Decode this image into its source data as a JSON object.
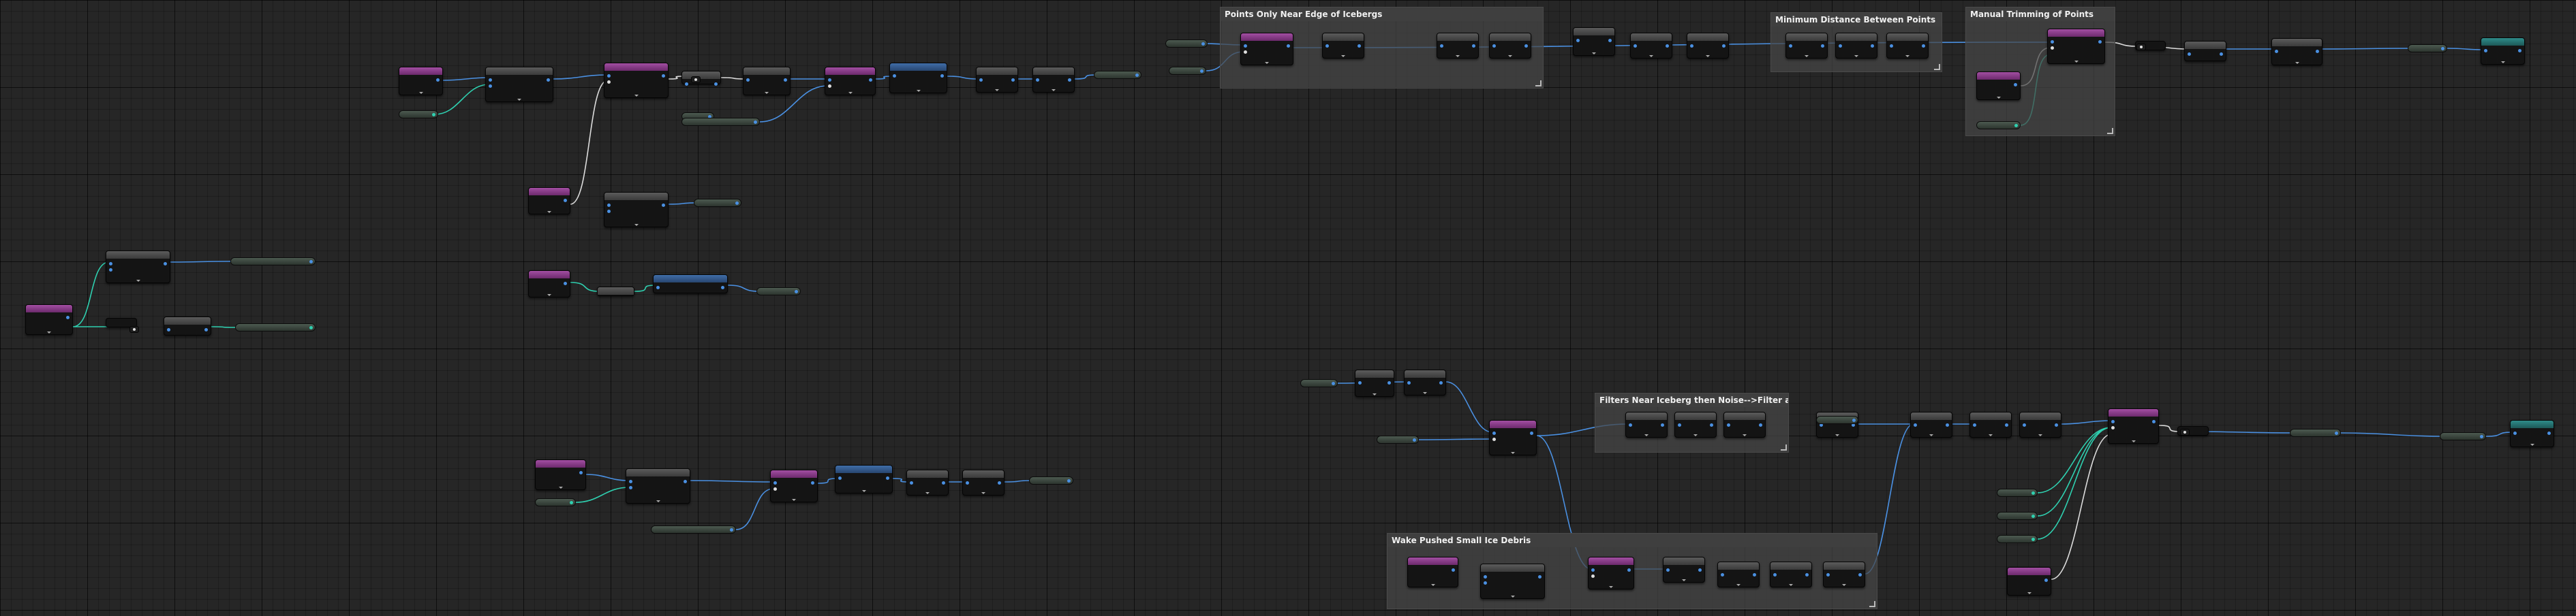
{
  "comments": [
    {
      "id": "c1",
      "title": "Points Only Near Edge of Icebergs"
    },
    {
      "id": "c2",
      "title": "Minimum Distance Between Points"
    },
    {
      "id": "c3",
      "title": "Manual Trimming of Points"
    },
    {
      "id": "c4",
      "title": "Filters Near Iceberg then Noise-->Filter again"
    },
    {
      "id": "c5",
      "title": "Wake Pushed Small Ice Debris"
    }
  ],
  "pin_colors": {
    "spatial": "#4a90e2",
    "point": "#4a90e2",
    "spline": "#2fd0b0",
    "exec": "#dddddd",
    "bool": "#c03030"
  }
}
